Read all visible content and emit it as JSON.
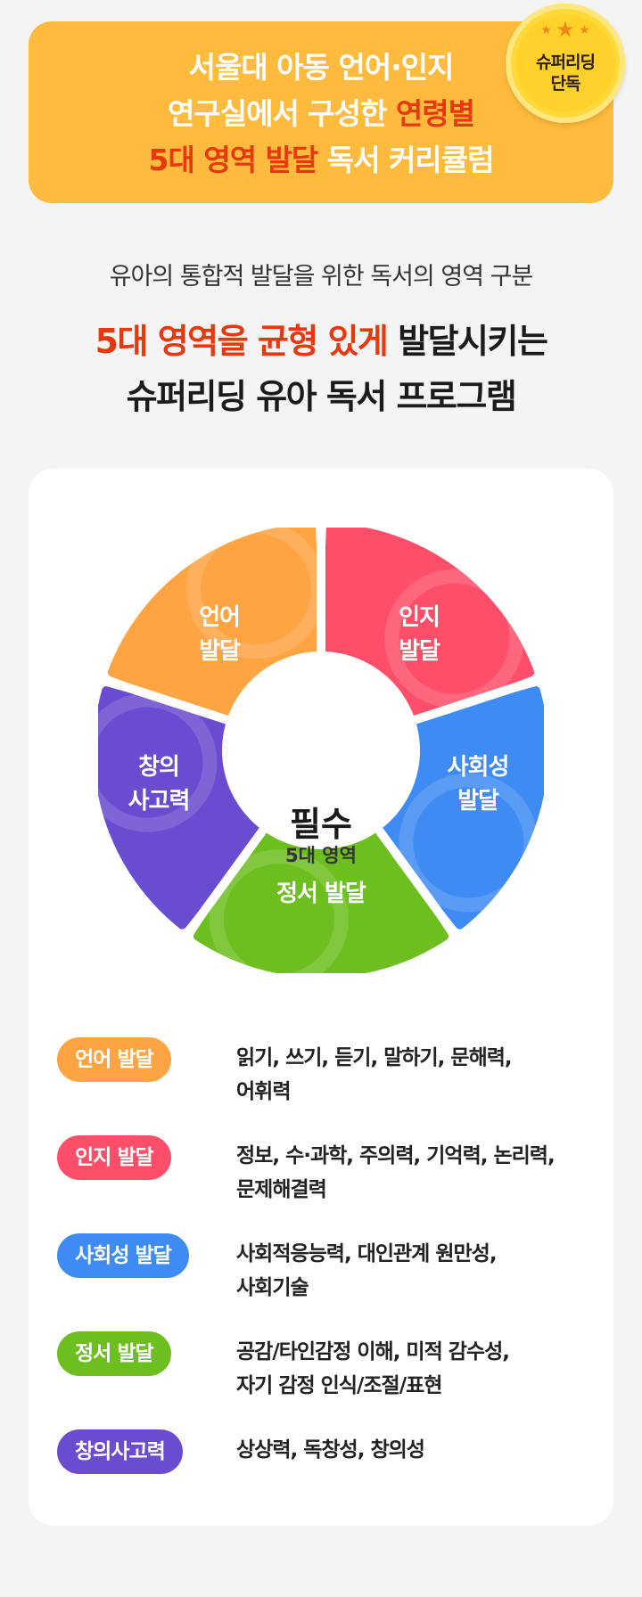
{
  "banner": {
    "line1": "서울대 아동 언어·인지",
    "line2_plain": "연구실에서 구성한 ",
    "line2_highlight": "연령별",
    "line3_highlight": "5대 영역 발달",
    "line3_plain": " 독서 커리큘럼",
    "badge_line1": "슈퍼리딩",
    "badge_line2": "단독",
    "badge_icon": "star-icon"
  },
  "subtitle": "유아의 통합적 발달을 위한 독서의 영역 구분",
  "headline": {
    "highlight": "5대 영역을 균형 있게",
    "plain": " 발달시키는",
    "line2": "슈퍼리딩 유아 독서 프로그램"
  },
  "wheel": {
    "center_title": "필수",
    "center_subtitle": "5대 영역",
    "segments": [
      {
        "line1": "언어",
        "line2": "발달",
        "color": "#ffa443"
      },
      {
        "line1": "인지",
        "line2": "발달",
        "color": "#ff4e6a"
      },
      {
        "line1": "사회성",
        "line2": "발달",
        "color": "#3e8bf4"
      },
      {
        "line1": "정서 발달",
        "line2": "",
        "color": "#6dbf1f"
      },
      {
        "line1": "창의",
        "line2": "사고력",
        "color": "#6b4bd0"
      }
    ]
  },
  "areas": [
    {
      "label": "언어 발달",
      "color": "#ffa443",
      "desc1": "읽기, 쓰기, 듣기, 말하기, 문해력,",
      "desc2": "어휘력"
    },
    {
      "label": "인지 발달",
      "color": "#ff4e6a",
      "desc1": "정보, 수·과학, 주의력, 기억력, 논리력,",
      "desc2": "문제해결력"
    },
    {
      "label": "사회성 발달",
      "color": "#3e8bf4",
      "desc1": "사회적응능력, 대인관계 원만성,",
      "desc2": "사회기술"
    },
    {
      "label": "정서 발달",
      "color": "#6dbf1f",
      "desc1": "공감/타인감정 이해, 미적 감수성,",
      "desc2": "자기 감정 인식/조절/표현"
    },
    {
      "label": "창의사고력",
      "color": "#6b4bd0",
      "desc1": "상상력, 독창성, 창의성",
      "desc2": ""
    }
  ]
}
